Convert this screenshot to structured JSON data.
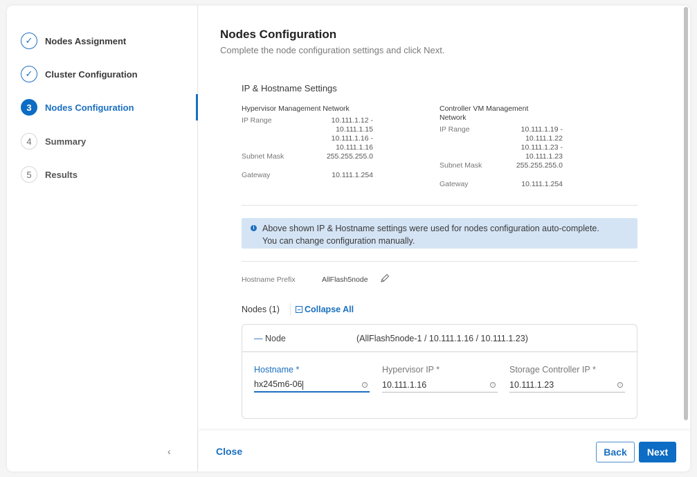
{
  "sidebar": {
    "steps": [
      {
        "number": "1",
        "label": "Nodes Assignment",
        "state": "done"
      },
      {
        "number": "2",
        "label": "Cluster Configuration",
        "state": "done"
      },
      {
        "number": "3",
        "label": "Nodes Configuration",
        "state": "active"
      },
      {
        "number": "4",
        "label": "Summary",
        "state": "todo"
      },
      {
        "number": "5",
        "label": "Results",
        "state": "todo"
      }
    ],
    "done_icon": "✓",
    "collapse_icon": "‹"
  },
  "main": {
    "title": "Nodes Configuration",
    "subtitle": "Complete the node configuration settings and click Next.",
    "section_title": "IP & Hostname Settings",
    "hypervisor": {
      "title": "Hypervisor Management Network",
      "ip_range_label": "IP Range",
      "ip_range": [
        "10.111.1.12 -",
        "10.111.1.15",
        "10.111.1.16 -",
        "10.111.1.16"
      ],
      "subnet_label": "Subnet Mask",
      "subnet": "255.255.255.0",
      "gateway_label": "Gateway",
      "gateway": "10.111.1.254"
    },
    "controller": {
      "title": "Controller VM Management Network",
      "ip_range_label": "IP Range",
      "ip_range": [
        "10.111.1.19 -",
        "10.111.1.22",
        "10.111.1.23 -",
        "10.111.1.23"
      ],
      "subnet_label": "Subnet Mask",
      "subnet": "255.255.255.0",
      "gateway_label": "Gateway",
      "gateway": "10.111.1.254"
    },
    "info": {
      "icon": "i",
      "line1": "Above shown IP & Hostname settings were used for nodes configuration auto-complete.",
      "line2": "You can change configuration manually."
    },
    "hostname_prefix_label": "Hostname Prefix",
    "hostname_prefix": "AllFlash5node",
    "nodes_label": "Nodes (1)",
    "collapse_all": "Collapse All",
    "node": {
      "toggle_dash": "—",
      "toggle_label": "Node",
      "summary": "(AllFlash5node-1 / 10.111.1.16 / 10.111.1.23)",
      "fields": [
        {
          "label": "Hostname *",
          "value": "hx245m6-06"
        },
        {
          "label": "Hypervisor IP *",
          "value": "10.111.1.16"
        },
        {
          "label": "Storage Controller IP *",
          "value": "10.111.1.23"
        }
      ],
      "field_icon": "i"
    }
  },
  "footer": {
    "close": "Close",
    "back": "Back",
    "next": "Next"
  }
}
